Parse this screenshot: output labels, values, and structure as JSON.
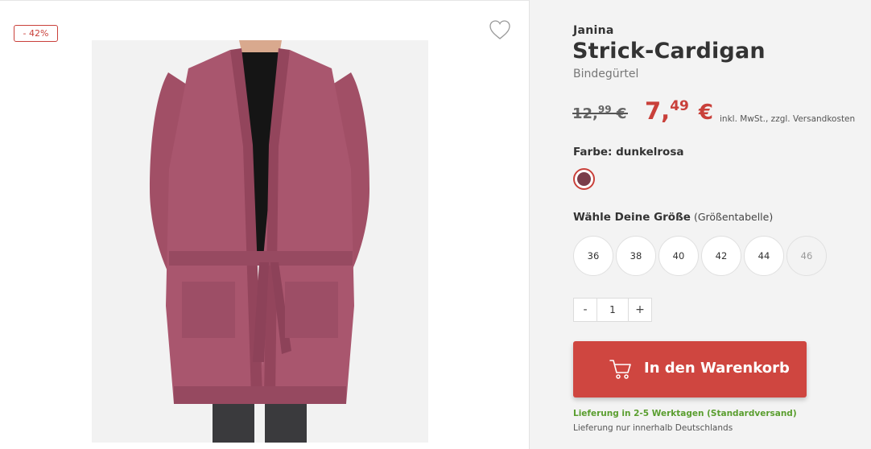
{
  "product": {
    "discount_badge": "- 42%",
    "brand": "Janina",
    "title": "Strick-Cardigan",
    "subtitle": "Bindegürtel",
    "image_alt": "Strick-Cardigan dunkelrosa"
  },
  "price": {
    "old_main": "12,",
    "old_cents": "99",
    "old_currency": "€",
    "new_main": "7,",
    "new_cents": "49",
    "new_currency": "€",
    "tax_note": "inkl. MwSt., zzgl. Versandkosten"
  },
  "color": {
    "label": "Farbe: dunkelrosa",
    "swatch_color": "#7a3d4a"
  },
  "sizes": {
    "label": "Wähle Deine Größe",
    "chart_link": "(Größentabelle)",
    "options": [
      "36",
      "38",
      "40",
      "42",
      "44",
      "46"
    ],
    "unavailable": [
      "46"
    ]
  },
  "quantity": {
    "minus": "-",
    "value": "1",
    "plus": "+"
  },
  "cart": {
    "button_label": "In den Warenkorb"
  },
  "delivery": {
    "line1": "Lieferung in 2-5 Werktagen (Standardversand)",
    "line2": "Lieferung nur innerhalb Deutschlands"
  },
  "colors": {
    "accent": "#cf4640",
    "delivery_green": "#5a9e2f"
  },
  "icons": {
    "wishlist": "heart-outline-icon",
    "cart": "shopping-cart-icon"
  }
}
